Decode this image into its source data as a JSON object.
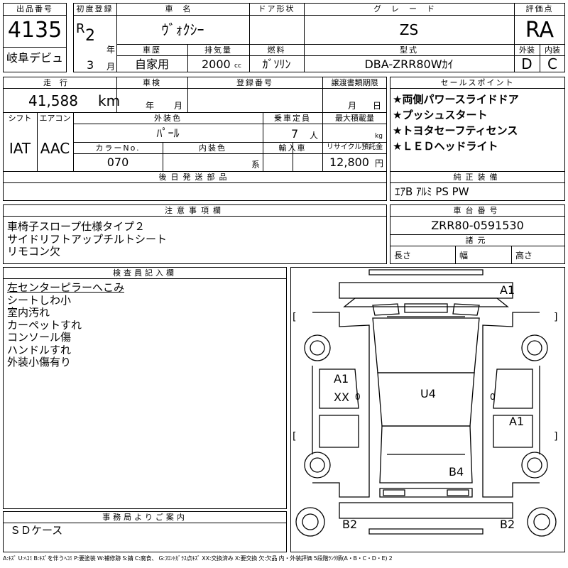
{
  "lot": {
    "label": "出品番号",
    "number": "4135",
    "venue": "岐阜デビュ"
  },
  "reg": {
    "label": "初度登録",
    "era": "R",
    "year": "2",
    "year_unit": "年",
    "month": "3",
    "month_unit": "月"
  },
  "car_name": {
    "label": "車名",
    "value": "ｳﾞｫｸｼｰ"
  },
  "door": {
    "label": "ドア形状",
    "value": ""
  },
  "grade": {
    "label": "グレード",
    "value": "ZS"
  },
  "score": {
    "label": "評価点",
    "value": "RA"
  },
  "history": {
    "label": "車歴",
    "value": "自家用"
  },
  "displacement": {
    "label": "排気量",
    "value": "2000",
    "unit": "cc"
  },
  "fuel": {
    "label": "燃料",
    "value": "ｶﾞｿﾘﾝ"
  },
  "model": {
    "label": "型式",
    "value": "DBA-ZRR80Wｶｲ"
  },
  "exterior_grade": {
    "label": "外装",
    "value": "D"
  },
  "interior_grade": {
    "label": "内装",
    "value": "C"
  },
  "mileage": {
    "label": "走行",
    "value": "41,588",
    "unit": "km"
  },
  "inspection": {
    "label": "車検",
    "year_unit": "年",
    "month_unit": "月"
  },
  "plate": {
    "label": "登録番号",
    "value": ""
  },
  "transfer": {
    "label": "譲渡書類期限",
    "month_unit": "月",
    "day_unit": "日"
  },
  "shift": {
    "label": "シフト",
    "value": "IAT"
  },
  "aircon": {
    "label": "エアコン",
    "value": "AAC"
  },
  "body_color": {
    "label": "外装色",
    "value": "ﾊﾟｰﾙ"
  },
  "capacity": {
    "label": "乗車定員",
    "value": "7",
    "unit": "人"
  },
  "max_load": {
    "label": "最大積載量",
    "unit": "kg"
  },
  "color_no": {
    "label": "カラーNo.",
    "value": "070"
  },
  "interior_color": {
    "label": "内装色",
    "unit": "系"
  },
  "import": {
    "label": "輸入車",
    "value": ""
  },
  "recycle": {
    "label": "リサイクル預託金",
    "value": "12,800",
    "unit": "円"
  },
  "sales_points": {
    "label": "セールスポイント",
    "items": [
      "★両側パワースライドドア",
      "★プッシュスタート",
      "★トヨタセーフティセンス",
      "★ＬＥＤヘッドライト"
    ]
  },
  "later_parts": {
    "label": "後日発送部品",
    "value": ""
  },
  "genuine": {
    "label": "純正装備",
    "value": "ｴｱB ｱﾙﾐ PS PW"
  },
  "notes": {
    "label": "注意事項欄",
    "lines": [
      "車椅子スロープ仕様タイプ２",
      "サイドリフトアップチルトシート",
      "リモコン欠"
    ]
  },
  "chassis": {
    "label": "車台番号",
    "value": "ZRR80-0591530"
  },
  "dims": {
    "label": "諸元",
    "length": "長さ",
    "width": "幅",
    "height": "高さ"
  },
  "inspector": {
    "label": "検査員記入欄",
    "lines": [
      "左センターピラーへこみ",
      "シートしわ小",
      "室内汚れ",
      "カーペットすれ",
      "コンソール傷",
      "ハンドルすれ",
      "外装小傷有り"
    ]
  },
  "office": {
    "label": "事務局よりご案内",
    "value": "ＳＤケース"
  },
  "diagram": {
    "marks": {
      "front_right": "A1",
      "left_door_a": "A1",
      "left_door_xx": "XX",
      "roof": "U4",
      "right_rear": "A1",
      "rear_window": "B4",
      "rear_left": "B2",
      "rear_right": "B2",
      "zero": "0",
      "bracket_l": "[",
      "bracket_r": "]"
    }
  },
  "legend": "A:ｷｽﾞ U:ﾍｺﾐ B:ｷｽﾞを伴うﾍｺﾐ P:要塗装 W:補修跡 S:錆 C:腐食、 G:ﾌﾛﾝﾄｶﾞﾗｽ点ｷｽﾞ XX:交換済み X:要交換 欠:欠品 内・外装評価 5段階ﾗﾝｸ順(A・B・C・D・E) 2"
}
